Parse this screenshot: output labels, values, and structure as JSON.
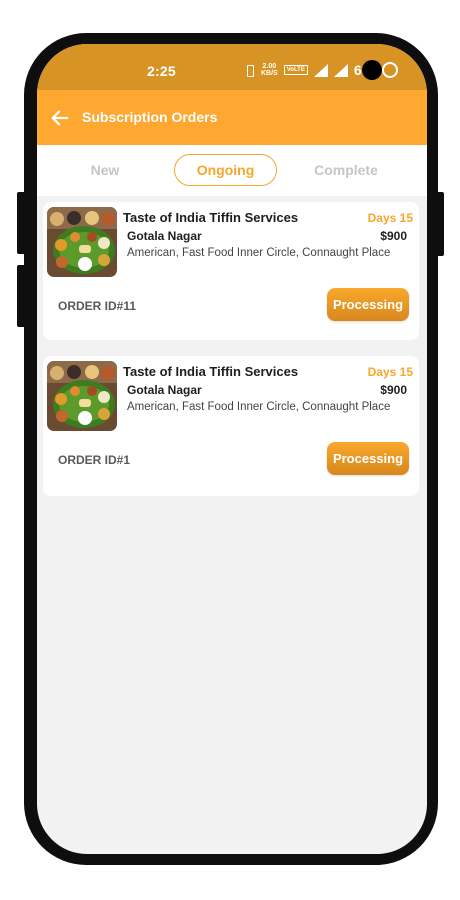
{
  "status_bar": {
    "time": "2:25",
    "net_speed_value": "2.00",
    "net_speed_unit": "KB/S",
    "volte": "VoLTE",
    "battery": "6"
  },
  "appbar": {
    "title": "Subscription Orders"
  },
  "tabs": [
    {
      "label": "New",
      "active": false
    },
    {
      "label": "Ongoing",
      "active": true
    },
    {
      "label": "Complete",
      "active": false
    }
  ],
  "orders": [
    {
      "name": "Taste of India Tiffin Services",
      "days": "Days 15",
      "area": "Gotala Nagar",
      "price": "$900",
      "cuisine": "American, Fast Food Inner Circle, Connaught Place",
      "order_id": "ORDER ID#11",
      "status": "Processing"
    },
    {
      "name": "Taste of India Tiffin Services",
      "days": "Days 15",
      "area": "Gotala Nagar",
      "price": "$900",
      "cuisine": "American, Fast Food Inner Circle, Connaught Place",
      "order_id": "ORDER ID#1",
      "status": "Processing"
    }
  ],
  "colors": {
    "accent": "#fea831",
    "status_bar": "#d79425",
    "background": "#f2f2f2"
  },
  "icons": {
    "back": "arrow-left-icon",
    "vibrate": "vibrate-icon",
    "signal": "signal-icon",
    "thumbnail": "food-platter-image"
  }
}
